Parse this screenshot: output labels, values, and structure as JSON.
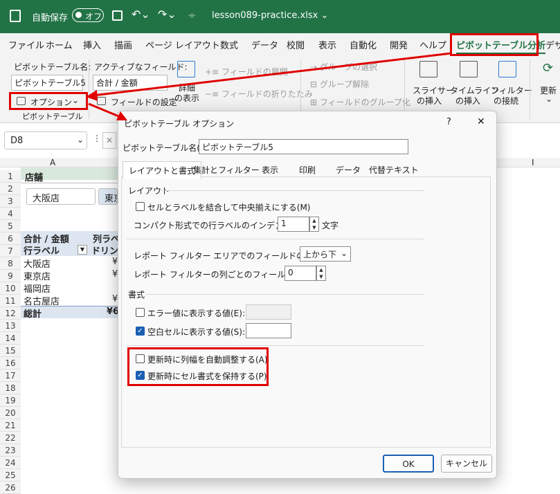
{
  "title_bar": {
    "autosave_label": "自動保存",
    "autosave_state": "オフ",
    "filename": "lesson089-practice.xlsx ⌄"
  },
  "ribbon_tabs": [
    "ファイル",
    "ホーム",
    "挿入",
    "描画",
    "ページ レイアウト",
    "数式",
    "データ",
    "校閲",
    "表示",
    "自動化",
    "開発",
    "ヘルプ",
    "ピボットテーブル分析",
    "デザ"
  ],
  "ribbon": {
    "pt_name_label": "ピボットテーブル名:",
    "pt_name_value": "ピボットテーブル5",
    "options_label": "オプション",
    "group_label": "ピボットテーブル",
    "active_field_label": "アクティブなフィールド:",
    "active_field_value": "合計 / 金額",
    "field_settings": "フィールドの設定",
    "detail_line1": "詳細",
    "detail_line2": "の表示",
    "expand_field": "フィールドの展開",
    "collapse_field": "フィールドの折りたたみ",
    "group_select": "グループの選択",
    "group_ungroup": "グループ解除",
    "group_field": "フィールドのグループ化",
    "slicer_1": "スライサー",
    "slicer_2": "の挿入",
    "timeline_1": "タイムライン",
    "timeline_2": "の挿入",
    "filter_1": "フィルター",
    "filter_2": "の接続",
    "refresh": "更新"
  },
  "formula_bar": {
    "cell_ref": "D8",
    "col_I": "I"
  },
  "sheet": {
    "col_A": "A",
    "row_numbers": [
      "1",
      "2",
      "3",
      "4",
      "5",
      "6",
      "7",
      "8",
      "9",
      "10",
      "11",
      "12",
      "13",
      "14",
      "15",
      "16",
      "17",
      "18",
      "19",
      "20",
      "21",
      "22",
      "23",
      "24",
      "25",
      "26"
    ],
    "title": "店舗",
    "slicer_osaka": "大阪店",
    "slicer_tokyo": "東京",
    "sum_header": "合計 / 金額",
    "col_label": "列ラベ",
    "row_label": "行ラベル",
    "drink": "ドリン",
    "stores": [
      "大阪店",
      "東京店",
      "福岡店",
      "名古屋店"
    ],
    "store_values": [
      "¥",
      "¥",
      "",
      "¥"
    ],
    "total_label": "総計",
    "total_value": "¥6"
  },
  "dialog": {
    "title": "ピボットテーブル オプション",
    "help": "?",
    "close": "✕",
    "name_label": "ピボットテーブル名(N):",
    "name_value": "ピボットテーブル5",
    "tabs": [
      "レイアウトと書式",
      "集計とフィルター",
      "表示",
      "印刷",
      "データ",
      "代替テキスト"
    ],
    "layout_section": "レイアウト",
    "merge_label": "セルとラベルを結合して中央揃えにする(M)",
    "indent_label": "コンパクト形式での行ラベルのインデント(C):",
    "indent_value": "1",
    "indent_unit": "文字",
    "filter_display_label": "レポート フィルター エリアでのフィールドの表示(D):",
    "filter_display_value": "上から下",
    "filter_count_label": "レポート フィルターの列ごとのフィールド数(F):",
    "filter_count_value": "0",
    "format_section": "書式",
    "error_label": "エラー値に表示する値(E):",
    "empty_label": "空白セルに表示する値(S):",
    "autofit_label": "更新時に列幅を自動調整する(A)",
    "preserve_label": "更新時にセル書式を保持する(P)",
    "ok": "OK",
    "cancel": "キャンセル"
  },
  "checkbox_states": {
    "merge": false,
    "error": false,
    "empty": true,
    "autofit": false,
    "preserve": true
  },
  "colors": {
    "excel_green": "#217346",
    "accent_blue": "#1a5fb4",
    "annotation_red": "#e00000"
  }
}
